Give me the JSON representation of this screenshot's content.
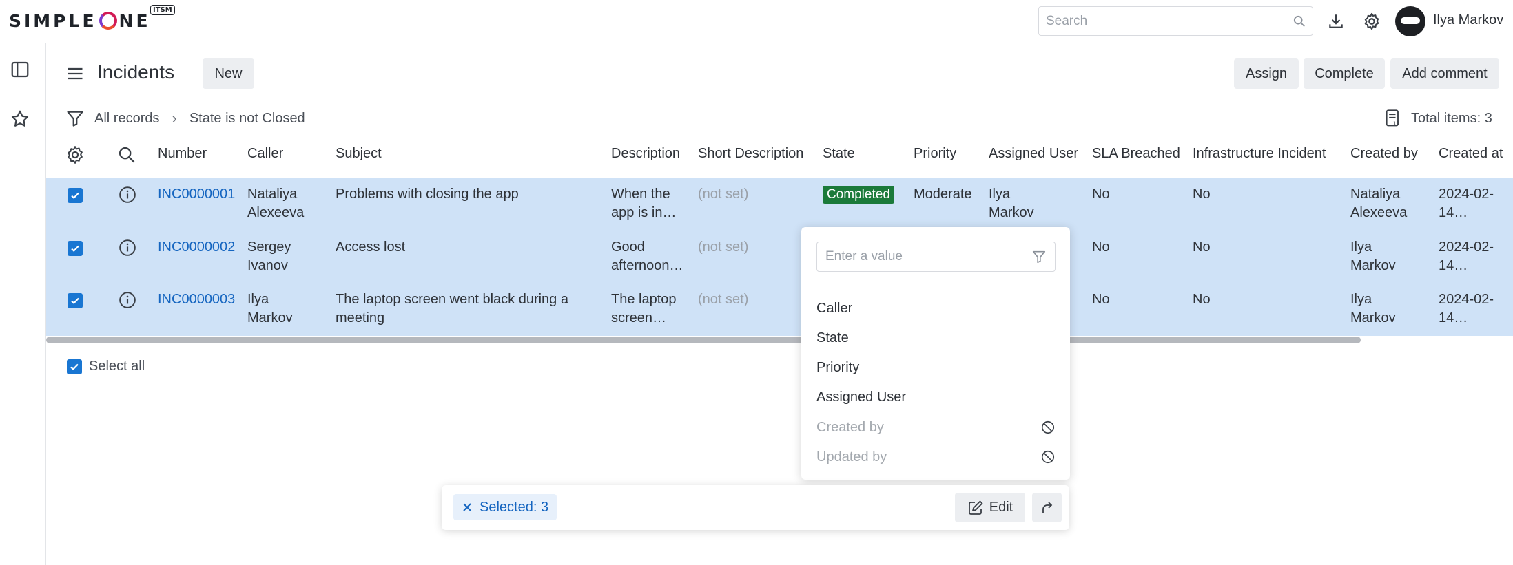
{
  "app": {
    "logo_text": "SIMPLEONE",
    "logo_badge": "ITSM"
  },
  "header": {
    "search_placeholder": "Search",
    "user_name": "Ilya Markov"
  },
  "page": {
    "title": "Incidents",
    "new_label": "New",
    "actions": {
      "assign": "Assign",
      "complete": "Complete",
      "add_comment": "Add comment"
    }
  },
  "filter": {
    "all_records": "All records",
    "condition": "State is not Closed",
    "total_label": "Total items: 3"
  },
  "table": {
    "columns": [
      "Number",
      "Caller",
      "Subject",
      "Description",
      "Short Description",
      "State",
      "Priority",
      "Assigned User",
      "SLA Breached",
      "Infrastructure Incident",
      "Created by",
      "Created at"
    ],
    "rows": [
      {
        "number": "INC0000001",
        "caller": [
          "Nataliya",
          "Alexeeva"
        ],
        "subject": [
          "Problems with closing the app"
        ],
        "description": [
          "When the",
          "app is in…"
        ],
        "short_description": "(not set)",
        "state": "Completed",
        "priority": "Moderate",
        "assigned_user": [
          "Ilya",
          "Markov"
        ],
        "sla_breached": "No",
        "infrastructure_incident": "No",
        "created_by": [
          "Nataliya",
          "Alexeeva"
        ],
        "created_at": [
          "2024-02-",
          "14…"
        ]
      },
      {
        "number": "INC0000002",
        "caller": [
          "Sergey",
          "Ivanov"
        ],
        "subject": [
          "Access lost"
        ],
        "description": [
          "Good",
          "afternoon…"
        ],
        "short_description": "(not set)",
        "sla_breached": "No",
        "infrastructure_incident": "No",
        "created_by": [
          "Ilya",
          "Markov"
        ],
        "created_at": [
          "2024-02-",
          "14…"
        ]
      },
      {
        "number": "INC0000003",
        "caller": [
          "Ilya",
          "Markov"
        ],
        "subject": [
          "The laptop screen went black during a",
          "meeting"
        ],
        "description": [
          "The laptop",
          "screen…"
        ],
        "short_description": "(not set)",
        "sla_breached": "No",
        "infrastructure_incident": "No",
        "created_by": [
          "Ilya",
          "Markov"
        ],
        "created_at": [
          "2024-02-",
          "14…"
        ]
      }
    ],
    "select_all_label": "Select all"
  },
  "dropdown": {
    "input_placeholder": "Enter a value",
    "items": [
      "Caller",
      "State",
      "Priority",
      "Assigned User"
    ],
    "disabled_items": [
      "Created by",
      "Updated by"
    ]
  },
  "action_bar": {
    "selected_label": "Selected: 3",
    "edit_label": "Edit"
  },
  "colors": {
    "selected_row": "#cfe2f7",
    "link": "#1565c0",
    "completed_badge": "#1b7a3a",
    "checkbox": "#1976d2"
  }
}
